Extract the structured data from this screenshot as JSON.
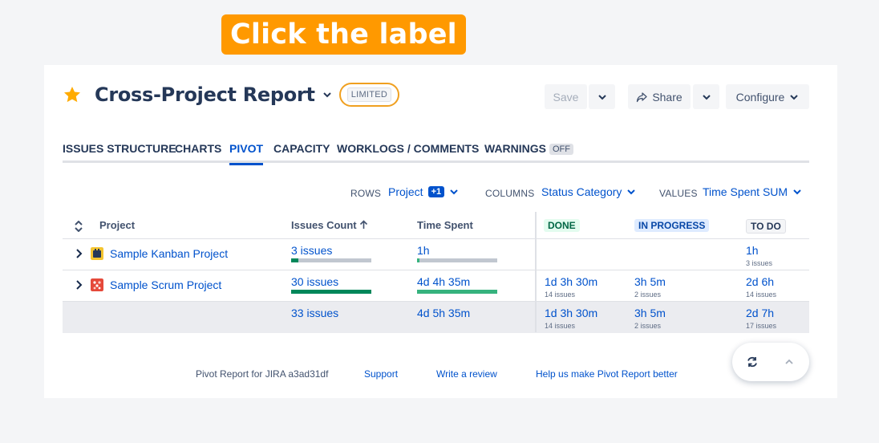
{
  "callout": "Click the label",
  "report": {
    "title": "Cross-Project Report",
    "badge": "LIMITED"
  },
  "toolbar": {
    "save": "Save",
    "share": "Share",
    "configure": "Configure"
  },
  "tabs": [
    {
      "label": "ISSUES STRUCTURE"
    },
    {
      "label": "CHARTS"
    },
    {
      "label": "PIVOT",
      "active": true
    },
    {
      "label": "CAPACITY"
    },
    {
      "label": "WORKLOGS / COMMENTS"
    },
    {
      "label": "WARNINGS",
      "badge": "OFF"
    }
  ],
  "config": {
    "rows_label": "ROWS",
    "rows_value": "Project",
    "rows_extra": "+1",
    "columns_label": "COLUMNS",
    "columns_value": "Status Category",
    "values_label": "VALUES",
    "values_value": "Time Spent SUM"
  },
  "table": {
    "headers": {
      "project": "Project",
      "issues_count": "Issues Count",
      "time_spent": "Time Spent",
      "done": "DONE",
      "in_progress": "IN PROGRESS",
      "to_do": "TO DO"
    },
    "rows": [
      {
        "project": "Sample Kanban Project",
        "issues": "3 issues",
        "issues_ratio": 0.09,
        "time": "1h",
        "time_ratio": 0.03,
        "done": "",
        "done_sub": "",
        "in_progress": "",
        "in_progress_sub": "",
        "to_do": "1h",
        "to_do_sub": "3 issues"
      },
      {
        "project": "Sample Scrum Project",
        "issues": "30 issues",
        "issues_ratio": 1.0,
        "time": "4d 4h 35m",
        "time_ratio": 1.0,
        "done": "1d 3h 30m",
        "done_sub": "14 issues",
        "in_progress": "3h 5m",
        "in_progress_sub": "2 issues",
        "to_do": "2d 6h",
        "to_do_sub": "14 issues"
      }
    ],
    "total": {
      "issues": "33 issues",
      "time": "4d 5h 35m",
      "done": "1d 3h 30m",
      "done_sub": "14 issues",
      "in_progress": "3h 5m",
      "in_progress_sub": "2 issues",
      "to_do": "2d 7h",
      "to_do_sub": "17 issues"
    }
  },
  "footer": {
    "version": "Pivot Report for JIRA a3ad31df",
    "support": "Support",
    "review": "Write a review",
    "improve": "Help us make Pivot Report better"
  },
  "colors": {
    "accent": "#0052cc",
    "callout": "#ff9900",
    "issues_bar": "#00875a",
    "time_bar": "#36b37e"
  }
}
